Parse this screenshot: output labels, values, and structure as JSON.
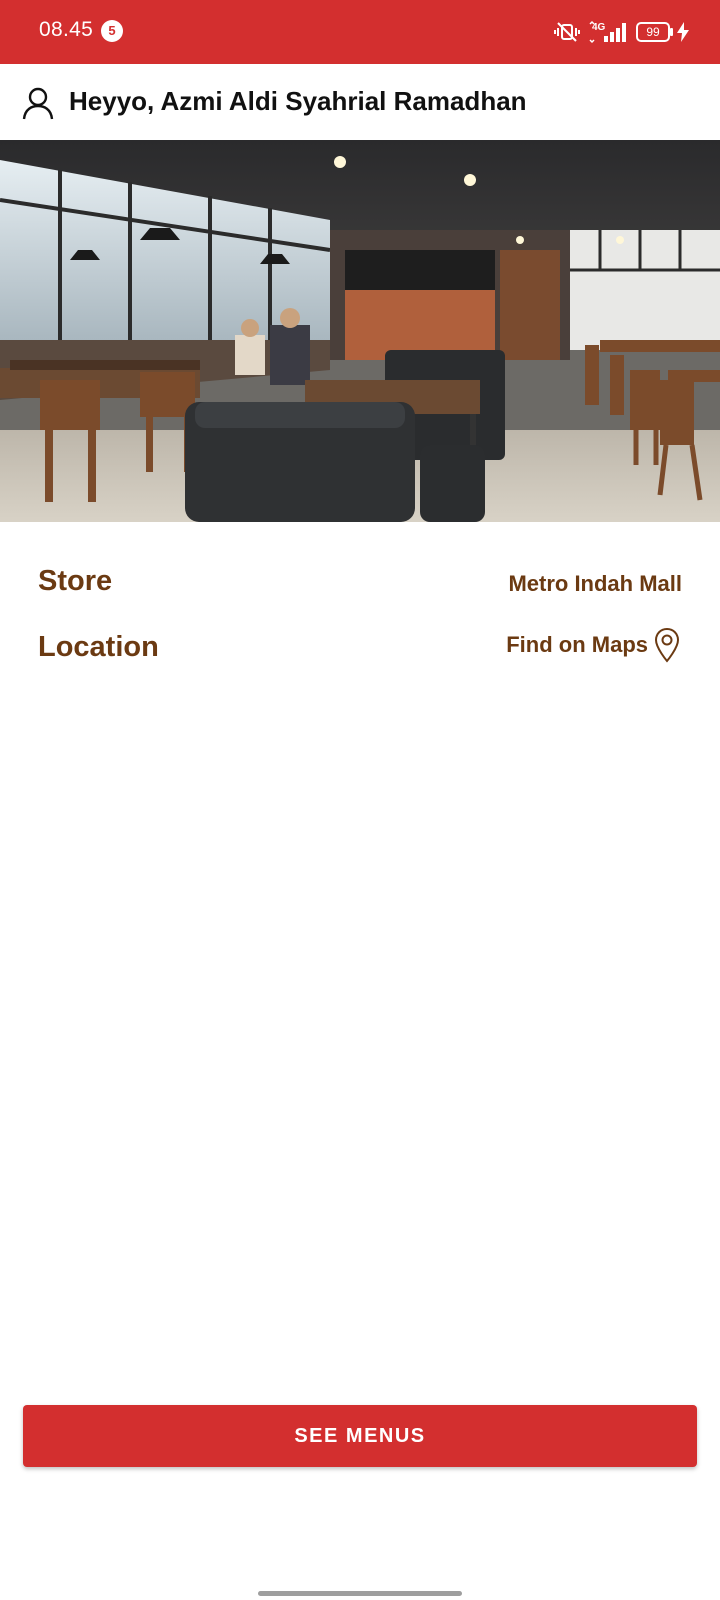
{
  "status_bar": {
    "time": "08.45",
    "notification_count": "5",
    "network": "4G",
    "battery": "99",
    "background": "#d32f2f"
  },
  "header": {
    "greeting": "Heyyo, Azmi Aldi Syahrial Ramadhan",
    "icon": "user-icon"
  },
  "store_info": {
    "store_label": "Store",
    "store_value": "Metro Indah Mall",
    "location_label": "Location",
    "location_value": "Find on Maps",
    "location_icon": "map-pin-icon",
    "text_color": "#6b3a12"
  },
  "actions": {
    "see_menus_label": "SEE MENUS",
    "button_color": "#d32f2f"
  }
}
